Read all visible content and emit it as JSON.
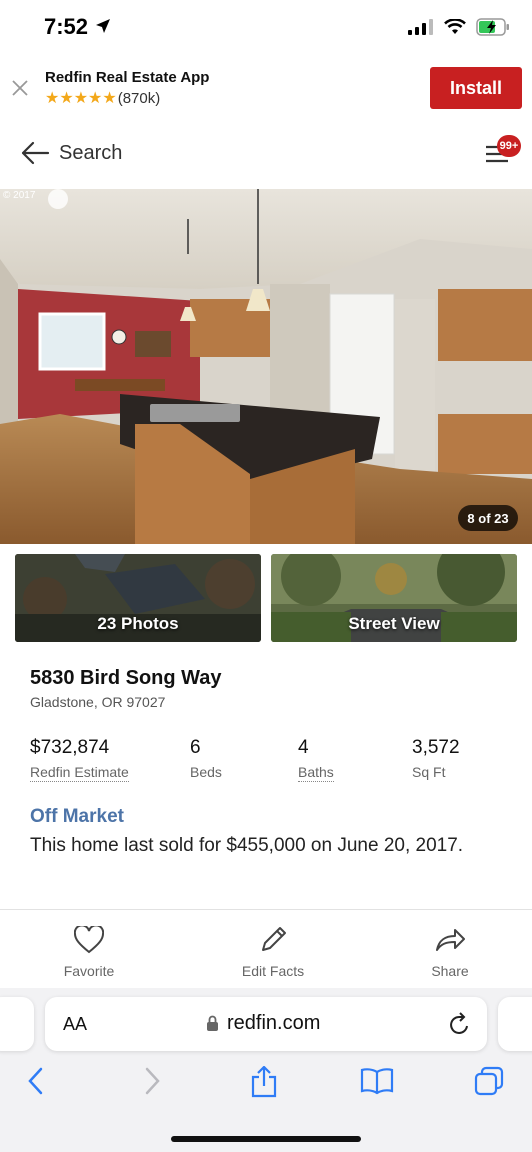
{
  "status_bar": {
    "time": "7:52"
  },
  "app_banner": {
    "title": "Redfin Real Estate App",
    "stars": "★★★★★",
    "rating_count": "(870k)",
    "install_label": "Install"
  },
  "nav": {
    "back_label": "Search",
    "notification_count": "99+"
  },
  "gallery": {
    "copyright": "© 2017",
    "counter": "8 of 23",
    "photos_label": "23 Photos",
    "street_view_label": "Street View"
  },
  "listing": {
    "address": "5830 Bird Song Way",
    "city": "Gladstone, OR 97027",
    "stats": [
      {
        "value": "$732,874",
        "label": "Redfin Estimate"
      },
      {
        "value": "6",
        "label": "Beds"
      },
      {
        "value": "4",
        "label": "Baths"
      },
      {
        "value": "3,572",
        "label": "Sq Ft"
      }
    ],
    "status": "Off Market",
    "sold_text": "This home last sold for $455,000 on June 20, 2017."
  },
  "actions": [
    {
      "label": "Favorite",
      "icon": "heart-icon"
    },
    {
      "label": "Edit Facts",
      "icon": "pencil-icon"
    },
    {
      "label": "Share",
      "icon": "share-icon"
    }
  ],
  "browser": {
    "text_size_label": "AA",
    "url": "redfin.com"
  },
  "colors": {
    "brand_red": "#c82021",
    "off_market_blue": "#4d74a8"
  }
}
